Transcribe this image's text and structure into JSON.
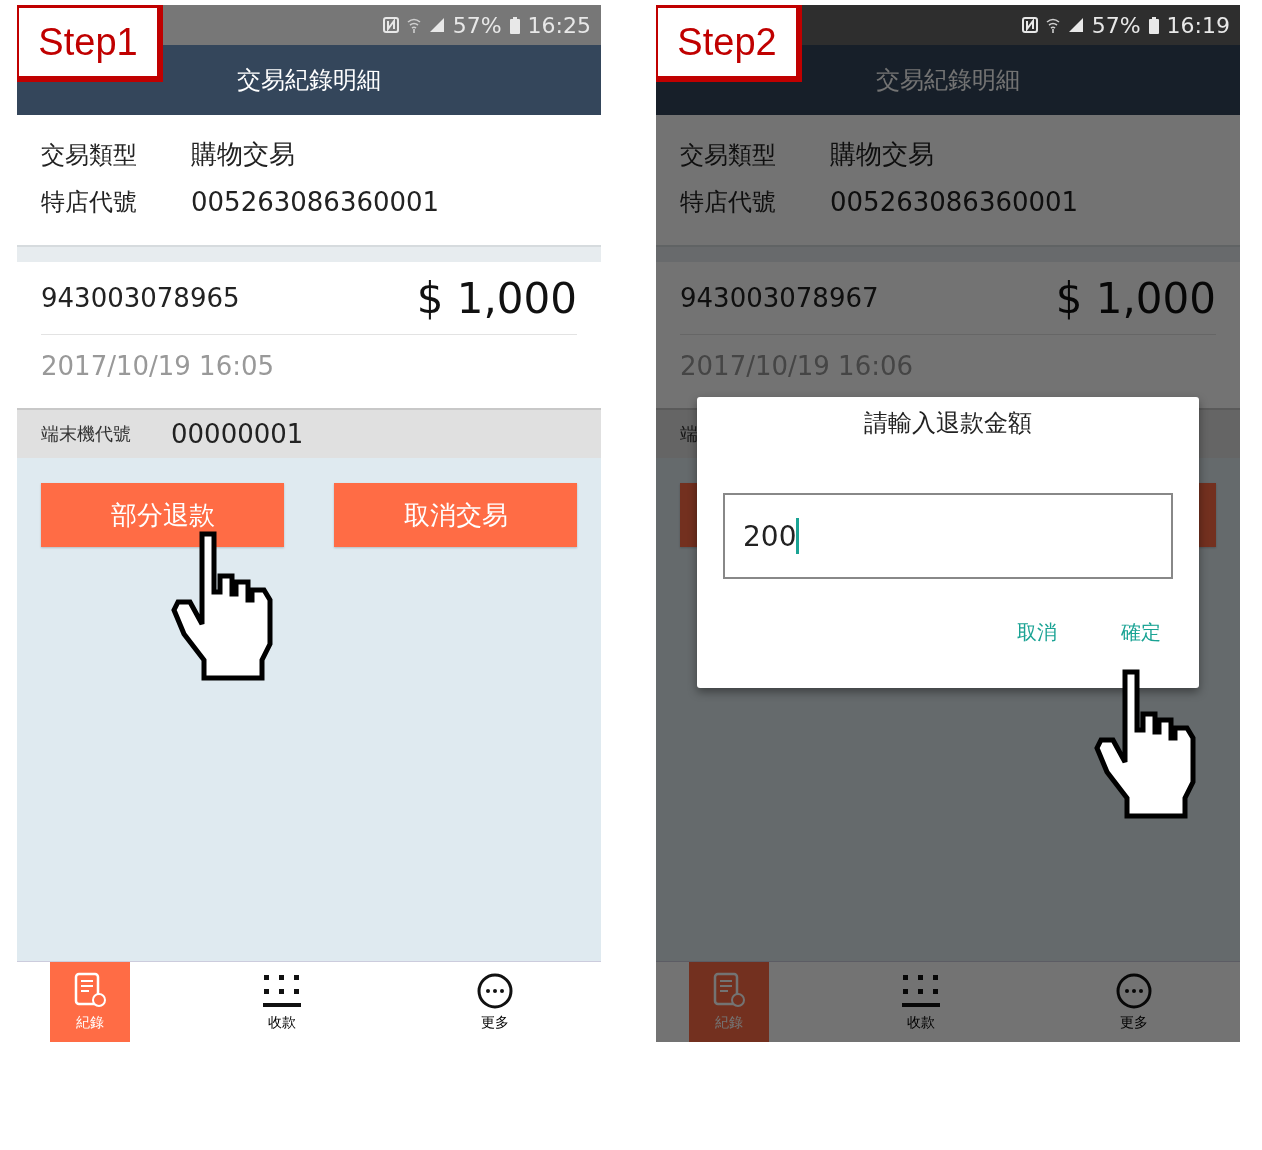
{
  "panels": [
    {
      "step": "Step1",
      "status": {
        "battery": "57%",
        "time": "16:25"
      },
      "title": "交易紀錄明細",
      "info": [
        {
          "label": "交易類型",
          "value": "購物交易"
        },
        {
          "label": "特店代號",
          "value": "005263086360001"
        }
      ],
      "card_no": "943003078965",
      "amount": "$ 1,000",
      "datetime": "2017/10/19 16:05",
      "terminal": {
        "label": "端末機代號",
        "value": "00000001"
      },
      "buttons": [
        {
          "label": "部分退款"
        },
        {
          "label": "取消交易"
        }
      ],
      "nav": [
        {
          "label": "紀錄",
          "selected": true
        },
        {
          "label": "收款",
          "selected": false
        },
        {
          "label": "更多",
          "selected": false
        }
      ]
    },
    {
      "step": "Step2",
      "status": {
        "battery": "57%",
        "time": "16:19"
      },
      "title": "交易紀錄明細",
      "info": [
        {
          "label": "交易類型",
          "value": "購物交易"
        },
        {
          "label": "特店代號",
          "value": "005263086360001"
        }
      ],
      "card_no": "943003078967",
      "amount": "$ 1,000",
      "datetime": "2017/10/19 16:06",
      "terminal": {
        "label": "端"
      },
      "nav": [
        {
          "label": "紀錄",
          "selected": true
        },
        {
          "label": "收款",
          "selected": false
        },
        {
          "label": "更多",
          "selected": false
        }
      ],
      "dialog": {
        "title": "請輸入退款金額",
        "value": "200",
        "actions": [
          "取消",
          "確定"
        ]
      }
    }
  ]
}
